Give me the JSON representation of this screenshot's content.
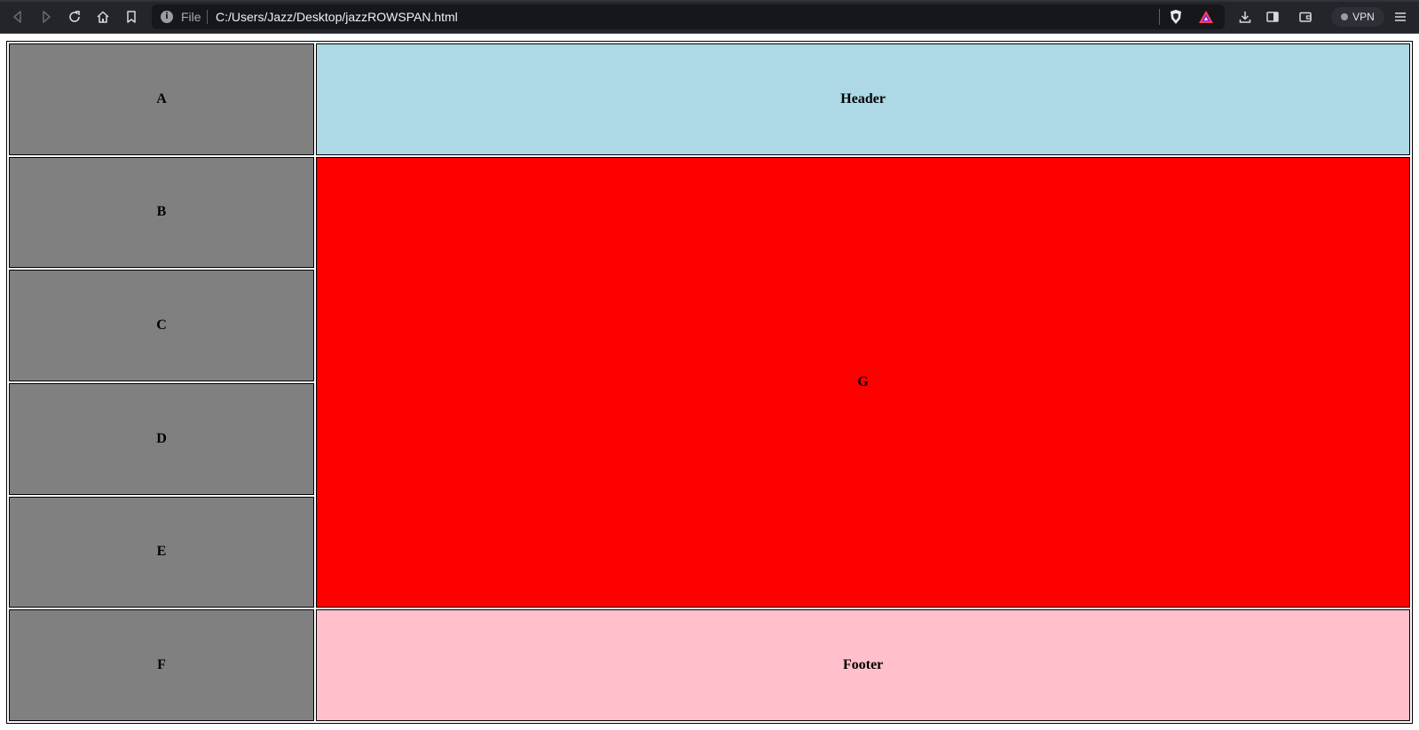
{
  "browser": {
    "scheme_label": "File",
    "url": "C:/Users/Jazz/Desktop/jazzROWSPAN.html",
    "vpn_label": "VPN"
  },
  "table": {
    "colors": {
      "side": "#808080",
      "header": "#add8e6",
      "main": "#ff0000",
      "footer": "#ffc0cb"
    },
    "cells": {
      "a": "A",
      "b": "B",
      "c": "C",
      "d": "D",
      "e": "E",
      "f": "F",
      "header": "Header",
      "g": "G",
      "footer": "Footer"
    }
  }
}
